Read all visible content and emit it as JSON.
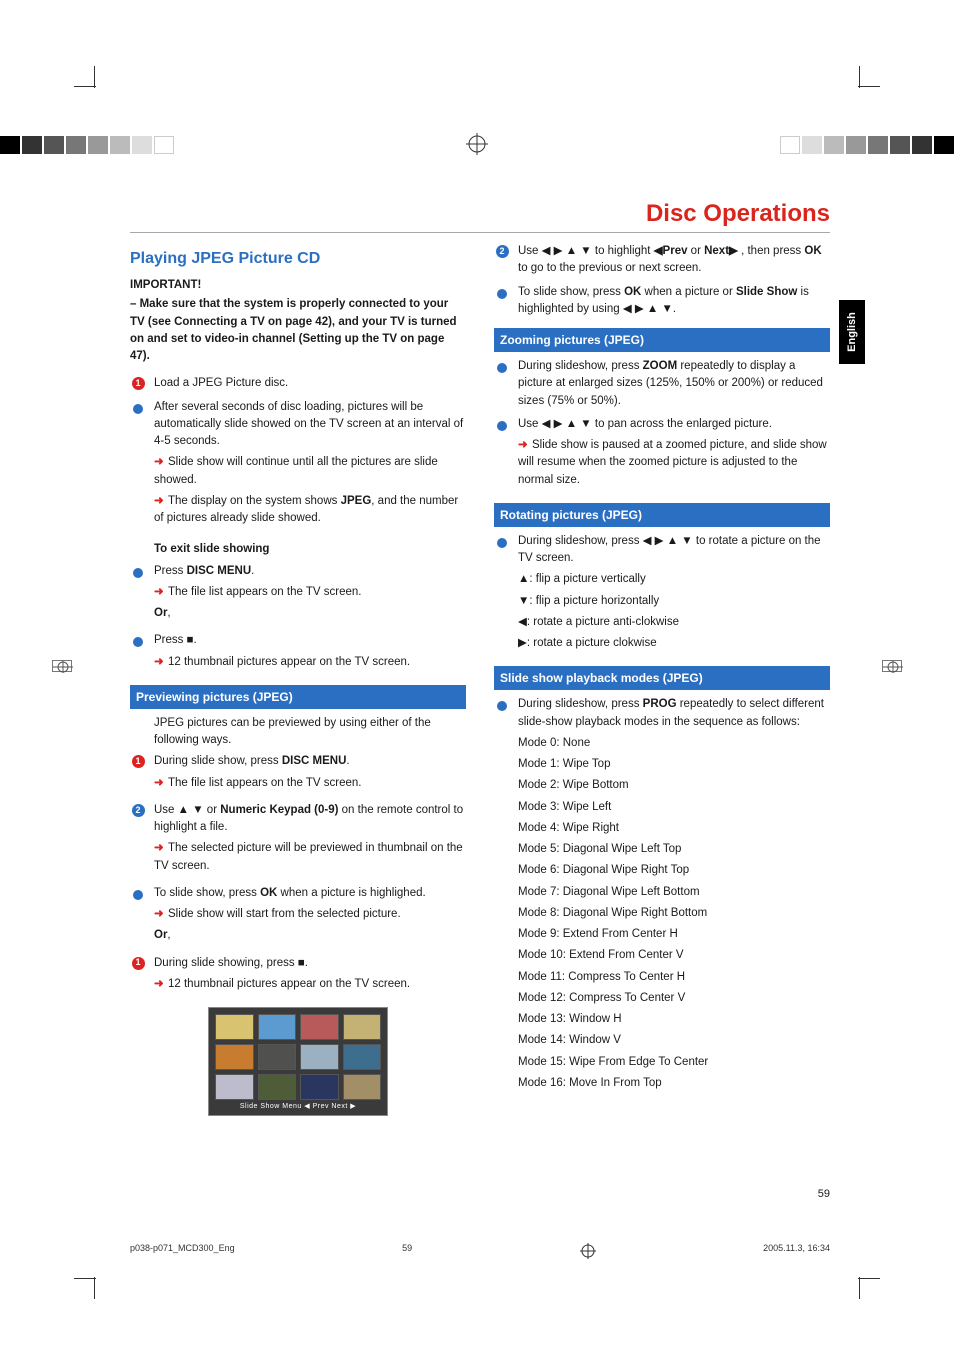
{
  "section_title": "Disc Operations",
  "side_tab": "English",
  "heading": "Playing JPEG Picture CD",
  "important_label": "IMPORTANT!",
  "important_text": "– Make sure that the system is properly connected to your TV (see Connecting a TV on page 42), and your TV is turned on and set to video-in channel (Setting up the TV on page 47).",
  "step1": "Load a JPEG Picture disc.",
  "bullet_after": "After several seconds of disc loading, pictures will be automatically slide showed on the TV screen at an interval of 4-5 seconds.",
  "arrow_slide_cont": "Slide show will continue until all the pictures are slide showed.",
  "arrow_display_pre": "The display on the system shows ",
  "arrow_display_bold": "JPEG",
  "arrow_display_post": ", and the number of pictures already slide showed.",
  "exit_heading": "To exit slide showing",
  "press_pre": "Press ",
  "disc_menu": "DISC MENU",
  "arrow_filelist": "The file list appears on the TV screen.",
  "or": "Or",
  "press_stop": "Press ■.",
  "arrow_12": "12 thumbnail pictures appear on the TV screen.",
  "bar_preview": "Previewing pictures (JPEG)",
  "preview_intro": "JPEG pictures can be previewed by using either of the following ways.",
  "during_slide_press": "During slide show, press ",
  "use_updown_pre": "Use ▲ ▼ or ",
  "numeric_keypad": "Numeric Keypad (0-9)",
  "use_updown_post": " on the remote control to highlight a file.",
  "arrow_selected": "The selected picture will be previewed in thumbnail on the TV screen.",
  "to_slide_ok_pre": "To slide show, press ",
  "ok": "OK",
  "to_slide_ok_post": " when a picture is highlighed.",
  "arrow_start_sel": "Slide show will start from the selected picture.",
  "during_showing_stop": "During slide showing, press ■.",
  "arrow_12_tv": "12 thumbnail pictures appear on the TV screen.",
  "thumb_caption": "Slide Show   Menu   ◀ Prev Next ▶",
  "use_nav_pre": "Use ◀ ▶ ▲ ▼ to highlight ",
  "prev": "◀Prev",
  "or_word": " or ",
  "next": "Next▶",
  "use_nav_post": " , then press ",
  "use_nav_end": " to go to the previous or next screen.",
  "to_slide_ok2_pre": "To slide show, press ",
  "to_slide_ok2_post": " when a picture or ",
  "slideshow_bold": "Slide Show",
  "slideshow_post": " is highlighted by using ◀ ▶ ▲ ▼.",
  "bar_zoom": "Zooming pictures (JPEG)",
  "zoom_pre": "During slideshow, press ",
  "zoom": "ZOOM",
  "zoom_post": " repeatedly to display a picture at enlarged sizes (125%, 150% or 200%) or reduced sizes (75% or 50%).",
  "zoom_pan": "Use ◀ ▶ ▲ ▼ to pan across the enlarged picture.",
  "arrow_zoom_pause": "Slide show is paused at a zoomed picture, and slide show will resume when the zoomed picture is adjusted to the normal size.",
  "bar_rotate": "Rotating pictures (JPEG)",
  "rotate_intro": "During slideshow, press ◀ ▶ ▲ ▼ to rotate a picture on the TV screen.",
  "rot_up": "▲: flip a picture vertically",
  "rot_down": "▼: flip a picture  horizontally",
  "rot_left": "◀: rotate a picture anti-clokwise",
  "rot_right": "▶: rotate a picture clokwise",
  "bar_modes": "Slide show playback modes (JPEG)",
  "modes_pre": "During slideshow, press ",
  "prog": "PROG",
  "modes_post": " repeatedly to select different slide-show playback modes in the sequence as follows:",
  "modes": [
    "Mode 0: None",
    "Mode 1: Wipe Top",
    "Mode 2: Wipe Bottom",
    "Mode 3: Wipe Left",
    "Mode 4: Wipe Right",
    "Mode 5: Diagonal Wipe Left Top",
    "Mode 6: Diagonal Wipe Right Top",
    "Mode 7: Diagonal Wipe Left Bottom",
    "Mode 8: Diagonal Wipe Right Bottom",
    "Mode 9: Extend From Center H",
    "Mode 10: Extend From Center V",
    "Mode 11: Compress To Center H",
    "Mode 12: Compress To Center V",
    "Mode 13: Window H",
    "Mode 14: Window V",
    "Mode 15: Wipe From Edge To Center",
    "Mode 16: Move In From Top"
  ],
  "pagenum": "59",
  "footer_left": "p038-p071_MCD300_Eng",
  "footer_mid": "59",
  "footer_right": "2005.11.3, 16:34",
  "colorbar": [
    "#000",
    "#333",
    "#555",
    "#777",
    "#999",
    "#bbb",
    "#ddd",
    "#fff"
  ],
  "thumb_colors": [
    "#d8c470",
    "#5b9bd0",
    "#b85a5a",
    "#c4b274",
    "#c77c30",
    "#50504f",
    "#9bb1c1",
    "#3e6e8e",
    "#bcbccc",
    "#4e5d37",
    "#2a3660",
    "#a38f67"
  ]
}
